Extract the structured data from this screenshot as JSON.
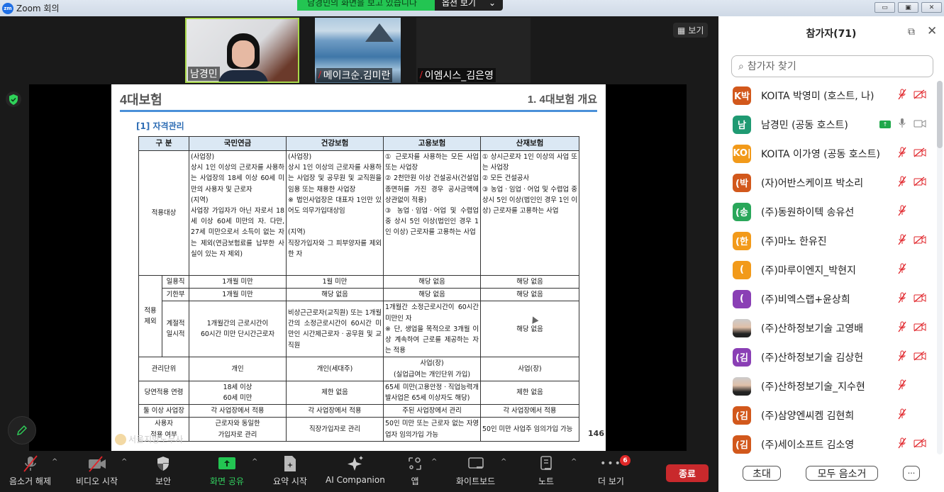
{
  "window": {
    "app_title": "Zoom 회의",
    "logo_text": "zm",
    "controls": [
      "minimize",
      "maximize",
      "close"
    ]
  },
  "share_banner": {
    "message": "남경민의 화면을 보고 있습니다",
    "options_label": "옵션 보기"
  },
  "video_tiles": [
    {
      "name": "남경민",
      "muted": false,
      "active_speaker": true
    },
    {
      "name": "메이크순.김미란",
      "muted": true,
      "active_speaker": false
    },
    {
      "name": "이엠시스_김은영",
      "muted": true,
      "active_speaker": false
    }
  ],
  "view_button": {
    "label": "보기"
  },
  "slide": {
    "title": "4대보험",
    "subtitle": "1. 4대보험 개요",
    "section": "[1] 자격관리",
    "page_number": "146",
    "watermark": "서울지방노무사",
    "table": {
      "headers": [
        "구 분",
        "국민연금",
        "건강보험",
        "고용보험",
        "산재보험"
      ],
      "rows": {
        "target": {
          "label": "적용대상",
          "cells": [
            "(사업장)\n상시 1인 이상의 근로자를 사용하는 사업장의 18세 이상 60세 미만의 사용자 및 근로자\n(지역)\n사업장 가입자가 아닌 자로서 18세 이상 60세 미만의 자. 다만, 27세 미만으로서 소득이 없는 자는 제외(연금보험료를 납부한 사실이 있는 자 제외)",
            "(사업장)\n상시 1인 이상의 근로자를 사용하는 사업장 및 공무원 및 교직원을 임용 또는 채용한 사업장\n※ 법인사업장은 대표자 1인만 있어도 의무가입대상임\n\n(지역)\n직장가입자와 그 피부양자를 제외한 자",
            "① 근로자를 사용하는 모든 사업 또는 사업장\n② 2천만원 이상 건설공사(건설업종면허를 가진 경우 공사금액에 상관없이 적용)\n③ 농업ㆍ임업ㆍ어업 및 수렵업 중 상시 5인 이상(법인인 경우 1인 이상) 근로자를 고용하는 사업",
            "① 상시근로자 1인 이상의 사업 또는 사업장\n② 모든 건설공사\n③ 농업ㆍ임업ㆍ어업 및 수렵업 중 상시 5인 이상(법인인 경우 1인 이상) 근로자를 고용하는 사업"
          ]
        },
        "exclusion": {
          "label": "적용\n제외",
          "sub": [
            {
              "label": "일용직",
              "cells": [
                "1개월 미만",
                "1월 미만",
                "해당 없음",
                "해당 없음"
              ]
            },
            {
              "label": "기한부",
              "cells": [
                "1개월 미만",
                "해당 없음",
                "해당 없음",
                "해당 없음"
              ]
            },
            {
              "label": "계절적\n일시적",
              "cells": [
                "1개월간의 근로시간이\n60시간 미만 단시간근로자",
                "비상근근로자(교직원) 또는 1개월간의 소정근로시간이 60시간 미만인 시간제근로자ㆍ공무원 및 교직원",
                "1개월간 소정근로시간이 60시간 미만인 자\n※ 단, 생업을 목적으로 3개월 이상 계속하여 근로를 제공하는 자는 적용",
                "해당 없음"
              ]
            }
          ]
        },
        "unit": {
          "label": "관리단위",
          "cells": [
            "개인",
            "개인(세대주)",
            "사업(장)\n(실업급여는 개인단위 가입)",
            "사업(장)"
          ]
        },
        "age": {
          "label": "당연적용 연령",
          "cells": [
            "18세 이상\n60세 미만",
            "제한 없음",
            "65세 미만(고용안정ㆍ직업능력개발사업은 65세 이상자도 해당)",
            "제한 없음"
          ]
        },
        "multi": {
          "label": "둘 이상 사업장",
          "cells": [
            "각 사업장에서 적용",
            "각 사업장에서 적용",
            "주된 사업장에서 관리",
            "각 사업장에서 적용"
          ]
        },
        "employer": {
          "label": "사용자\n적용 여부",
          "cells": [
            "근로자와 동일한\n가입자로 관리",
            "직장가입자로 관리",
            "50인 미만 또는 근로자 없는 자영업자 임의가입 가능",
            "50인 미만 사업주 임의가입 가능"
          ]
        }
      }
    }
  },
  "toolbar": {
    "items": [
      {
        "id": "unmute",
        "label": "음소거 해제",
        "icon": "mic-off-icon",
        "caret": true
      },
      {
        "id": "video",
        "label": "비디오 시작",
        "icon": "video-off-icon",
        "caret": true
      },
      {
        "id": "security",
        "label": "보안",
        "icon": "shield-icon",
        "caret": false
      },
      {
        "id": "share",
        "label": "화면 공유",
        "icon": "share-screen-icon",
        "caret": true
      },
      {
        "id": "summary",
        "label": "요약 시작",
        "icon": "summary-icon",
        "caret": false
      },
      {
        "id": "ai",
        "label": "AI Companion",
        "icon": "sparkle-icon",
        "caret": false
      },
      {
        "id": "apps",
        "label": "앱",
        "icon": "apps-icon",
        "caret": true
      },
      {
        "id": "whiteboard",
        "label": "화이트보드",
        "icon": "whiteboard-icon",
        "caret": true
      },
      {
        "id": "notes",
        "label": "노트",
        "icon": "notes-icon",
        "caret": true
      },
      {
        "id": "more",
        "label": "더 보기",
        "icon": "more-icon",
        "caret": false
      }
    ],
    "more_badge": "6",
    "end_label": "종료"
  },
  "participants_panel": {
    "title": "참가자(71)",
    "search_placeholder": "참가자 찾기",
    "participants": [
      {
        "avatar": "K박",
        "color": "#d2581c",
        "name": "KOITA 박영미 (호스트, 나)",
        "mic": "off",
        "cam": "off"
      },
      {
        "avatar": "남",
        "color": "#1f9a72",
        "name": "남경민 (공동 호스트)",
        "mic": "on",
        "cam": "on",
        "sharing": true
      },
      {
        "avatar": "KO|",
        "color": "#f29a1a",
        "name": "KOITA 이가영 (공동 호스트)",
        "mic": "off",
        "cam": "off"
      },
      {
        "avatar": "(박",
        "color": "#d2581c",
        "name": "(자)어반스케이프 박소리",
        "mic": "off",
        "cam": "off"
      },
      {
        "avatar": "(송",
        "color": "#2aa75a",
        "name": "(주)동원하이텍 송유선",
        "mic": "off",
        "cam": "none"
      },
      {
        "avatar": "(한",
        "color": "#f29a1a",
        "name": "(주)마노 한유진",
        "mic": "off",
        "cam": "off"
      },
      {
        "avatar": "(",
        "color": "#f29a1a",
        "name": "(주)마루이엔지_박현지",
        "mic": "off",
        "cam": "none"
      },
      {
        "avatar": "(",
        "color": "#8a3fb5",
        "name": "(주)비엑스랩+윤상희",
        "mic": "off",
        "cam": "off"
      },
      {
        "avatar": "",
        "photo": true,
        "name": "(주)산하정보기술 고영배",
        "mic": "off",
        "cam": "off"
      },
      {
        "avatar": "(김",
        "color": "#8a3fb5",
        "name": "(주)산하정보기술 김상헌",
        "mic": "off",
        "cam": "off"
      },
      {
        "avatar": "",
        "photo": true,
        "name": "(주)산하정보기술_지수현",
        "mic": "off",
        "cam": "none"
      },
      {
        "avatar": "(김",
        "color": "#d2581c",
        "name": "(주)삼양엔씨켐 김현희",
        "mic": "off",
        "cam": "none"
      },
      {
        "avatar": "(김",
        "color": "#d2581c",
        "name": "(주)세이소프트 김소영",
        "mic": "off",
        "cam": "off"
      }
    ],
    "footer": {
      "invite_label": "초대",
      "mute_all_label": "모두 음소거",
      "more_label": "···"
    }
  },
  "colors": {
    "accent_green": "#23c552",
    "end_red": "#c9292c",
    "muted_red": "#e0242a",
    "table_header": "#dbe8f4",
    "rule_blue": "#4a90d9"
  }
}
